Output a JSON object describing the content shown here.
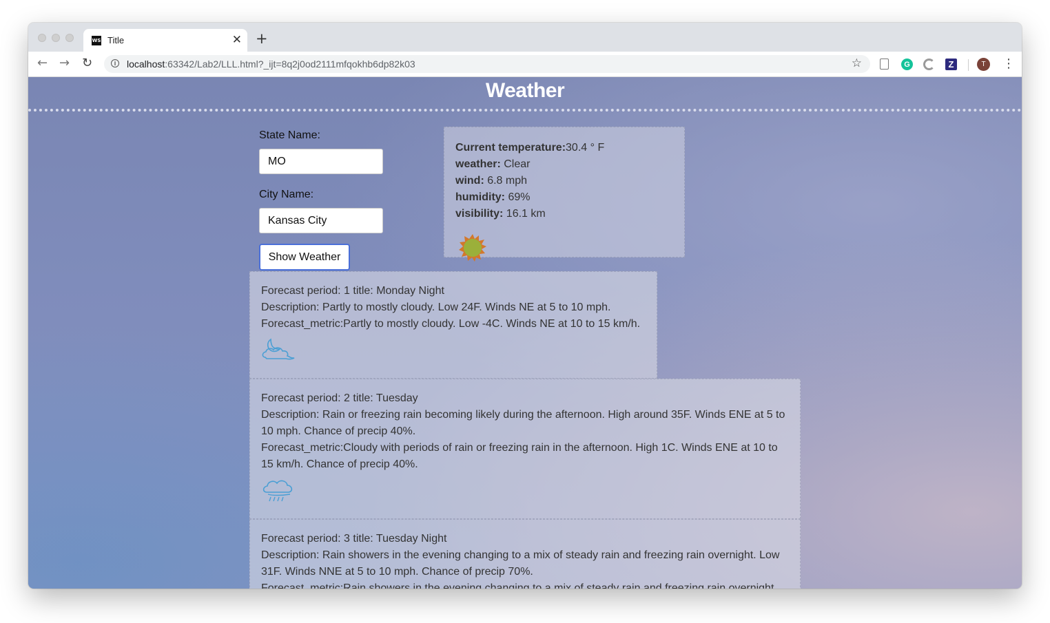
{
  "browser": {
    "tab_icon_text": "WS",
    "tab_title": "Title",
    "tab_close": "✕",
    "new_tab": "+",
    "back": "←",
    "forward": "→",
    "reload": "↻",
    "url_host": "localhost",
    "url_rest": ":63342/Lab2/LLL.html?_ijt=8q2j0od2111mfqokhb6dp82k03",
    "bookmark": "☆",
    "ext_grammarly": "G",
    "ext_z": "Z",
    "avatar_initial": "T",
    "menu": "⋮"
  },
  "page": {
    "title": "Weather",
    "state_label": "State Name:",
    "state_value": "MO",
    "city_label": "City Name:",
    "city_value": "Kansas City",
    "submit_label": "Show Weather"
  },
  "current": {
    "temperature_label": "Current temperature:",
    "temperature_value": "30.4 ° F",
    "weather_label": "weather:",
    "weather_value": " Clear",
    "wind_label": "wind:",
    "wind_value": " 6.8 mph",
    "humidity_label": "humidity:",
    "humidity_value": " 69%",
    "visibility_label": "visibility:",
    "visibility_value": " 16.1 km",
    "icon": "sun-icon"
  },
  "forecast": [
    {
      "heading": "Forecast period: 1 title: Monday Night",
      "description": "Description: Partly to mostly cloudy. Low 24F. Winds NE at 5 to 10 mph.",
      "metric": "Forecast_metric:Partly to mostly cloudy. Low -4C. Winds NE at 10 to 15 km/h.",
      "icon": "partly-cloudy-night-icon"
    },
    {
      "heading": "Forecast period: 2 title: Tuesday",
      "description": "Description: Rain or freezing rain becoming likely during the afternoon. High around 35F. Winds ENE at 5 to 10 mph. Chance of precip 40%.",
      "metric": "Forecast_metric:Cloudy with periods of rain or freezing rain in the afternoon. High 1C. Winds ENE at 10 to 15 km/h. Chance of precip 40%.",
      "icon": "rain-cloud-icon"
    },
    {
      "heading": "Forecast period: 3 title: Tuesday Night",
      "description": "Description: Rain showers in the evening changing to a mix of steady rain and freezing rain overnight. Low 31F. Winds NNE at 5 to 10 mph. Chance of precip 70%.",
      "metric": "Forecast_metric:Rain showers in the evening changing to a mix of steady rain and freezing rain overnight."
    }
  ],
  "colors": {
    "page_bg": "#7f8cbb",
    "title": "#ffffff",
    "button_border": "#4a6fd8",
    "icon_blue": "#4a9fd4",
    "sun_fill": "#9bb03a",
    "sun_rays": "#d3782a"
  }
}
